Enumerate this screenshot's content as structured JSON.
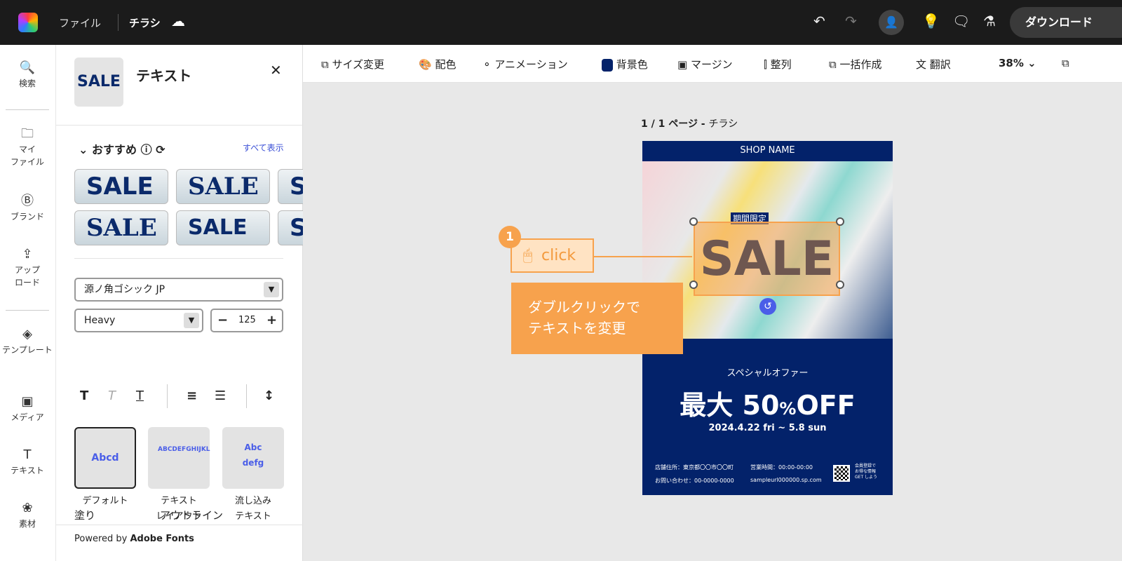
{
  "topbar": {
    "file": "ファイル",
    "doc_title": "チラシ",
    "download": "ダウンロード"
  },
  "rail": [
    "検索",
    "マイ\nファイル",
    "ブランド",
    "アップ\nロード",
    "テンプレート",
    "メディア",
    "テキスト",
    "素材"
  ],
  "panel": {
    "thumb": "SALE",
    "title": "テキスト",
    "recommended": "おすすめ",
    "show_all": "すべて表示",
    "tiles": [
      "SALE",
      "SALE",
      "S",
      "SALE",
      "SALE",
      "S"
    ],
    "font": "源ノ角ゴシック JP",
    "weight": "Heavy",
    "size": "125",
    "cards": [
      {
        "preview": "Abcd",
        "label": "デフォルト"
      },
      {
        "preview": "ABCDEFGHIJKL",
        "label": "テキスト\nレイアウト"
      },
      {
        "preview": "Abc defg",
        "label": "流し込み\nテキスト"
      }
    ],
    "fill": "塗り",
    "outline": "アウトライン",
    "powered": "Powered by ",
    "powered_bold": "Adobe Fonts"
  },
  "toolbar": {
    "items": [
      "サイズ変更",
      "配色",
      "アニメーション",
      "背景色",
      "マージン",
      "整列",
      "一括作成",
      "翻訳"
    ],
    "zoom": "38%",
    "bg_color": "#03226a"
  },
  "canvas": {
    "page_label": "1 / 1 ページ - ",
    "page_name": "チラシ"
  },
  "flyer": {
    "shop": "SHOP NAME",
    "limited": "期間限定",
    "sale": "SALE",
    "special": "スペシャルオファー",
    "offer_a": "最大 ",
    "offer_b": "50",
    "offer_c": "%",
    "offer_d": "OFF",
    "dates": "2024.4.22 fri ~ 5.8 sun",
    "address": "店舗住所：東京都〇〇市〇〇町",
    "hours": "営業時間：00:00-00:00",
    "contact": "お問い合わせ：00-0000-0000",
    "url": "sampleurl000000.sp.com",
    "member": "会員登録で\nお得な情報\nGET しよう"
  },
  "annotation": {
    "number": "1",
    "click": "click",
    "tip": "ダブルクリックで\nテキストを変更"
  }
}
